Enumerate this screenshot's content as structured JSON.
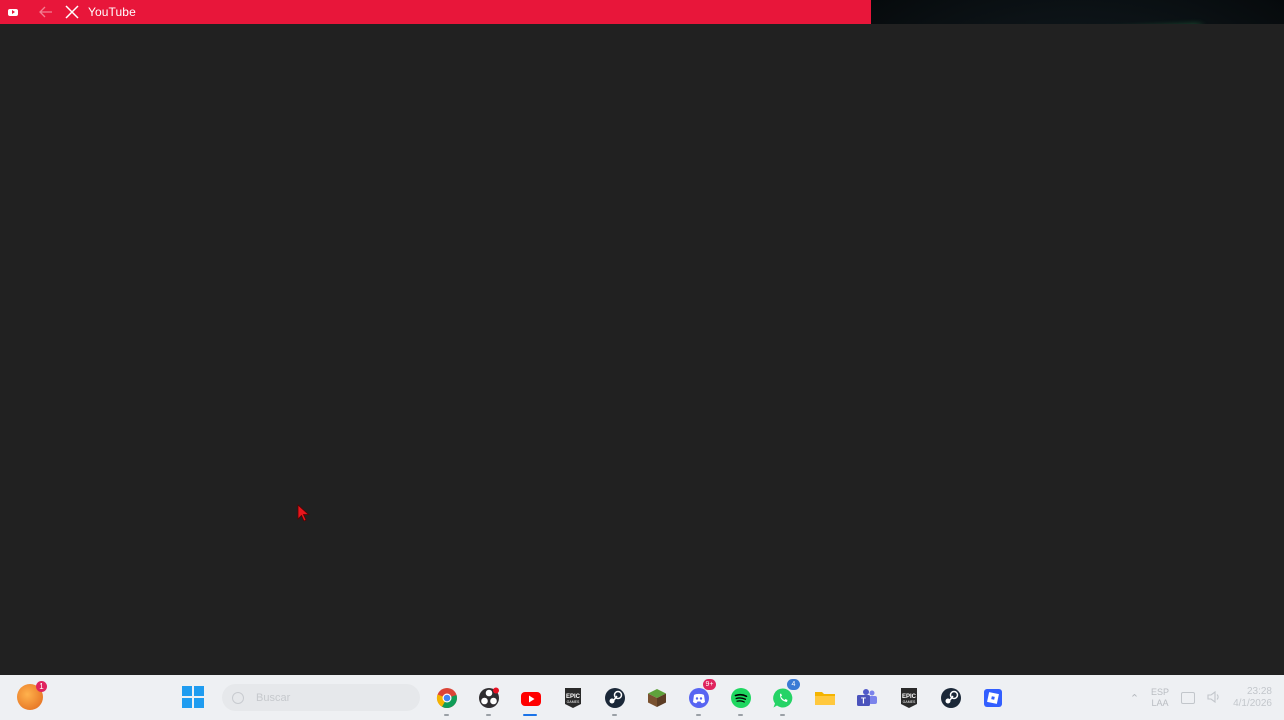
{
  "window": {
    "title": "YouTube",
    "titlebar_color": "#e8163a",
    "back_icon": "arrow-left-icon",
    "close_icon": "close-icon"
  },
  "webcam": {
    "present": true
  },
  "taskbar": {
    "search_placeholder": "Buscar",
    "user_badge": "1",
    "start_icon": "windows-icon",
    "apps": [
      {
        "id": "chrome",
        "icon": "chrome-icon",
        "active": false,
        "badge": ""
      },
      {
        "id": "obs",
        "icon": "obs-icon",
        "active": false,
        "badge": ""
      },
      {
        "id": "youtube",
        "icon": "youtube-icon",
        "active": true,
        "badge": ""
      },
      {
        "id": "epic-games",
        "icon": "epic-games-icon",
        "active": false,
        "badge": ""
      },
      {
        "id": "steam",
        "icon": "steam-icon",
        "active": false,
        "badge": ""
      },
      {
        "id": "minecraft",
        "icon": "minecraft-icon",
        "active": false,
        "badge": ""
      },
      {
        "id": "discord",
        "icon": "discord-icon",
        "active": false,
        "badge": "9+"
      },
      {
        "id": "spotify",
        "icon": "spotify-icon",
        "active": false,
        "badge": ""
      },
      {
        "id": "whatsapp",
        "icon": "whatsapp-icon",
        "active": false,
        "badge": "4"
      },
      {
        "id": "file-explorer",
        "icon": "folder-icon",
        "active": false,
        "badge": ""
      },
      {
        "id": "teams",
        "icon": "teams-icon",
        "active": false,
        "badge": ""
      },
      {
        "id": "epic-games-2",
        "icon": "epic-games-icon",
        "active": false,
        "badge": ""
      },
      {
        "id": "steam-2",
        "icon": "steam-icon",
        "active": false,
        "badge": ""
      },
      {
        "id": "roblox",
        "icon": "roblox-icon",
        "active": false,
        "badge": ""
      }
    ],
    "tray": {
      "language_line1": "ESP",
      "language_line2": "LAA",
      "time": "23:28",
      "date": "4/1/2026"
    }
  }
}
